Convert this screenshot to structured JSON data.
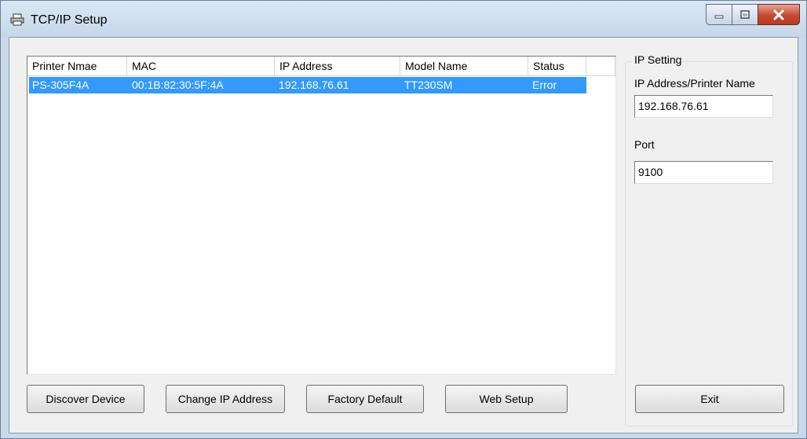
{
  "window": {
    "title": "TCP/IP Setup",
    "icon": "printer-icon"
  },
  "device_list": {
    "columns": [
      "Printer Nmae",
      "MAC",
      "IP Address",
      "Model Name",
      "Status"
    ],
    "rows": [
      {
        "printer_name": "PS-305F4A",
        "mac": "00:1B:82:30:5F:4A",
        "ip": "192.168.76.61",
        "model": "TT230SM",
        "status": "Error",
        "selected": true
      }
    ]
  },
  "ip_setting": {
    "group_label": "IP Setting",
    "address_label": "IP Address/Printer Name",
    "address_value": "192.168.76.61",
    "port_label": "Port",
    "port_value": "9100"
  },
  "buttons": {
    "discover": "Discover Device",
    "change_ip": "Change IP Address",
    "factory_default": "Factory Default",
    "web_setup": "Web Setup",
    "exit": "Exit"
  },
  "colors": {
    "selection": "#3399ff",
    "close_button": "#c54a30"
  }
}
